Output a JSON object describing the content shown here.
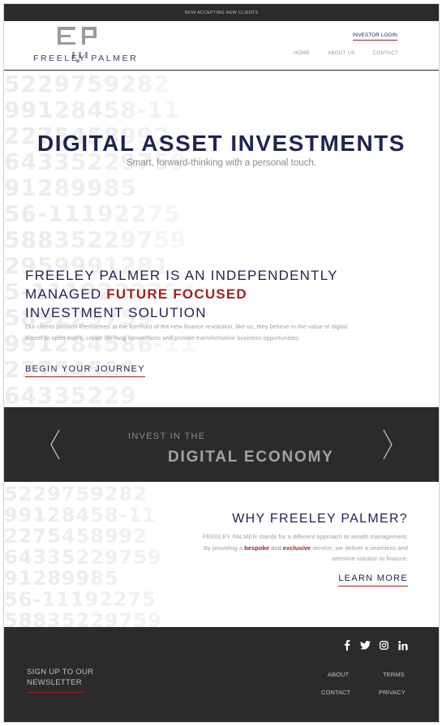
{
  "topbar": {
    "message": "NOW ACCEPTING NEW CLIENTS"
  },
  "header": {
    "logo_text": "FREELEY PALMER",
    "investor_login": "INVESTOR LOGIN",
    "nav": [
      "HOME",
      "ABOUT US",
      "CONTACT"
    ]
  },
  "hero": {
    "title": "DIGITAL ASSET INVESTMENTS",
    "subtitle": "Smart, forward-thinking with a personal touch.",
    "heading_line1": "FREELEY PALMER IS AN INDEPENDENTLY",
    "heading_line2_a": "MANAGED ",
    "heading_line2_b": "FUTURE FOCUSED",
    "heading_line3": "INVESTMENT SOLUTION",
    "paragraph": "Our clients position themselves at the forefront of the new finance revolution, like us, they believe in the value of digital assets to open doors, create life-long connections and provide transformative business opportunities.",
    "cta": "BEGIN YOUR JOURNEY",
    "bg_numbers": [
      "5229759282",
      "99128458-11",
      "2275458992",
      "64335229759",
      "91289985",
      "56-11192275",
      "58835229759",
      "2959991281",
      "5-1119222754",
      "589229759",
      "991284586-11",
      "22754589",
      "64335229"
    ]
  },
  "banner": {
    "line1": "INVEST IN THE",
    "line2": "DIGITAL ECONOMY"
  },
  "why": {
    "title": "WHY FREELEY PALMER?",
    "p1": "FREELEY PALMER stands for a different approach to wealth management.",
    "p2_a": "By providing a ",
    "p2_bespoke": "bespoke",
    "p2_and": " and ",
    "p2_exclusive": "exclusive",
    "p2_b": " service, we deliver a seamless and",
    "p3": "attentive solution to finance.",
    "cta": "LEARN MORE",
    "bg_numbers": [
      "5229759282",
      "99128458-11",
      "2275458992",
      "64335229759",
      "91289985",
      "56-11192275",
      "58835229759"
    ]
  },
  "footer": {
    "social": [
      "facebook-icon",
      "twitter-icon",
      "instagram-icon",
      "linkedin-icon"
    ],
    "newsletter_line1": "SIGN UP TO OUR",
    "newsletter_line2": "NEWSLETTER",
    "links": {
      "about": "ABOUT",
      "terms": "TERMS",
      "contact": "CONTACT",
      "privacy": "PRIVACY"
    }
  },
  "colors": {
    "navy": "#1f2450",
    "red": "#a31f24",
    "dark": "#2b2b2b"
  }
}
